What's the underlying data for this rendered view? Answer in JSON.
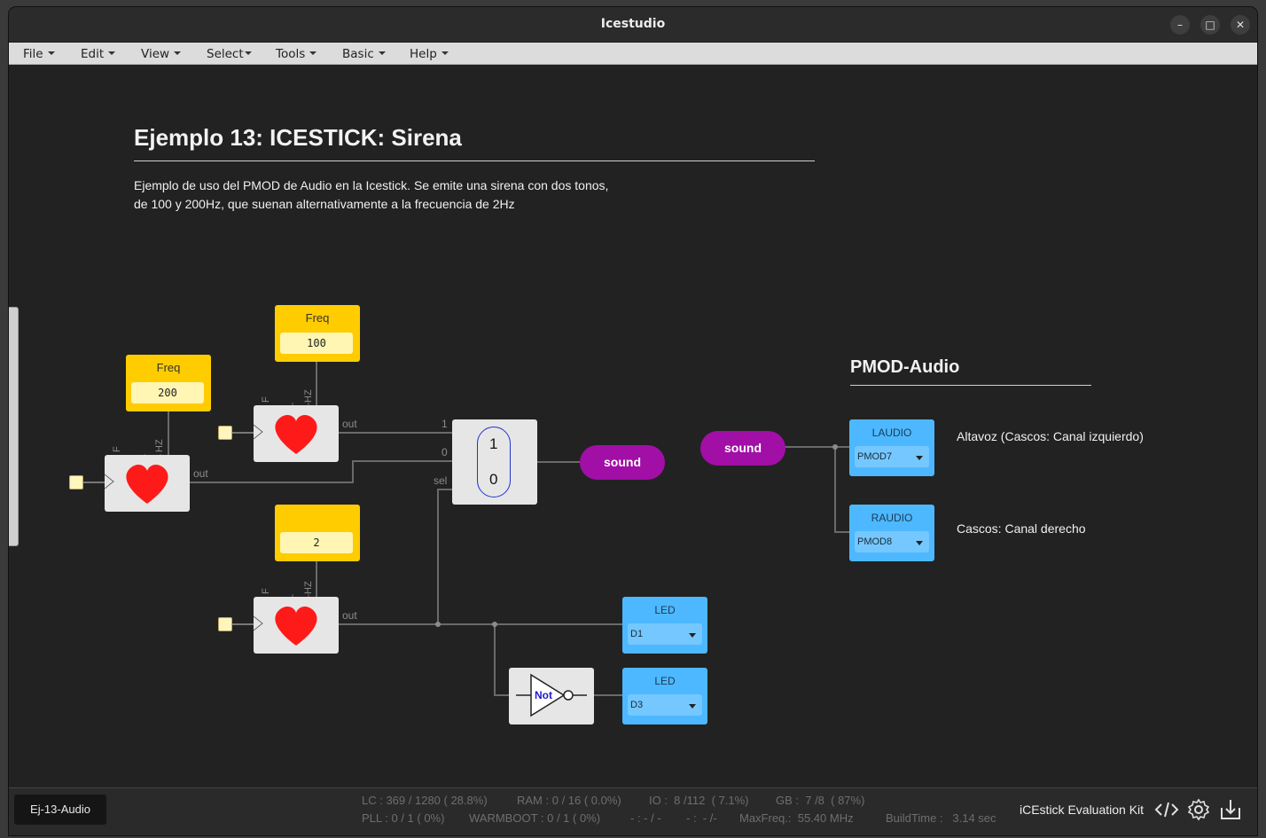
{
  "window": {
    "title": "Icestudio"
  },
  "menu": [
    "File",
    "Edit",
    "View",
    "Select",
    "Tools",
    "Basic",
    "Help"
  ],
  "doc": {
    "title": "Ejemplo 13: ICESTICK: Sirena",
    "desc_line1": "Ejemplo de uso del PMOD de Audio en la Icestick. Se emite una sirena con dos tonos,",
    "desc_line2": "de 100 y 200Hz, que suenan alternativamente a la frecuencia de 2Hz"
  },
  "pmod": {
    "title": "PMOD-Audio",
    "left_note": "Altavoz (Cascos: Canal izquierdo)",
    "right_note": "Cascos: Canal derecho"
  },
  "constants": {
    "freq200": {
      "label": "Freq",
      "value": "200"
    },
    "freq100": {
      "label": "Freq",
      "value": "100"
    },
    "freq2": {
      "label": "",
      "value": "2"
    }
  },
  "ports": {
    "out": "out",
    "F": "F",
    "HZ": "HZ",
    "one": "1",
    "zero": "0",
    "sel": "sel"
  },
  "mux": {
    "in1": "1",
    "in0": "0"
  },
  "labels": {
    "sound_out": "sound",
    "sound_in": "sound"
  },
  "outputs": {
    "laudio": {
      "label": "LAUDIO",
      "value": "PMOD7"
    },
    "raudio": {
      "label": "RAUDIO",
      "value": "PMOD8"
    },
    "led1": {
      "label": "LED",
      "value": "D1"
    },
    "led3": {
      "label": "LED",
      "value": "D3"
    }
  },
  "not_gate": {
    "label": "Not"
  },
  "status": {
    "tab": "Ej-13-Audio",
    "lc": "LC : 369 / 1280 ( 28.8%)",
    "ram": "RAM : 0 / 16 ( 0.0%)",
    "io": "IO :  8 /112  ( 7.1%)",
    "gb": "GB :  7 /8  ( 87%)",
    "pll": "PLL : 0 / 1 ( 0%)",
    "warmboot": "WARMBOOT : 0 / 1 ( 0%)",
    "dash1": "- : - / -",
    "dash2": "- :  - /-",
    "maxfreq": "MaxFreq.:  55.40 MHz",
    "buildtime": "BuildTime :   3.14 sec",
    "board": "iCEstick Evaluation Kit"
  },
  "colors": {
    "constant": "#ffcc00",
    "io": "#4db8ff",
    "label": "#a10fa6",
    "heart": "#ff1a1a"
  },
  "icons": [
    "minimize-icon",
    "maximize-icon",
    "close-icon",
    "code-icon",
    "gear-icon",
    "upload-icon",
    "heart-icon",
    "not-gate-icon"
  ]
}
